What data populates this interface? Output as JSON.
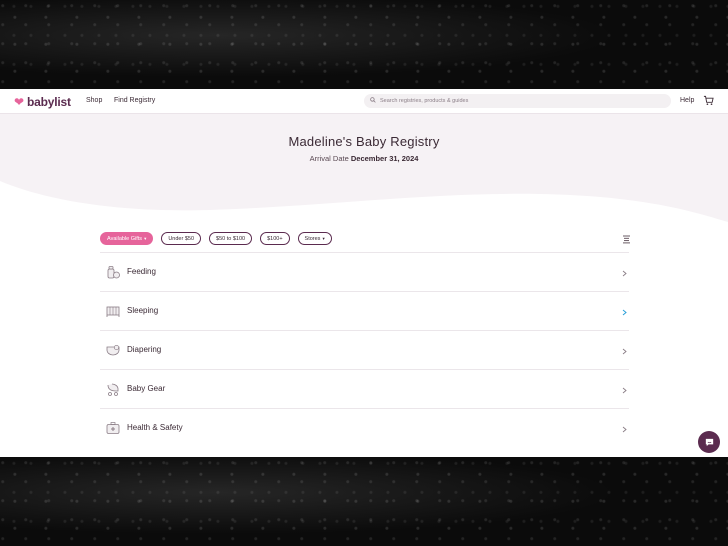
{
  "header": {
    "logo_text": "babylist",
    "nav": {
      "shop": "Shop",
      "find_registry": "Find Registry",
      "help": "Help"
    },
    "search": {
      "placeholder": "Search registries, products & guides",
      "icon": "search-icon"
    },
    "cart_icon": "cart-icon"
  },
  "hero": {
    "title": "Madeline's Baby Registry",
    "arrival_label": "Arrival Date",
    "arrival_date": "December 31, 2024"
  },
  "filters": [
    {
      "label": "Available Gifts",
      "active": true,
      "has_caret": true
    },
    {
      "label": "Under $50",
      "active": false,
      "has_caret": false
    },
    {
      "label": "$50 to $100",
      "active": false,
      "has_caret": false
    },
    {
      "label": "$100+",
      "active": false,
      "has_caret": false
    },
    {
      "label": "Stores",
      "active": false,
      "has_caret": true
    }
  ],
  "categories": [
    {
      "label": "Feeding",
      "icon": "bottle-icon"
    },
    {
      "label": "Sleeping",
      "icon": "crib-icon"
    },
    {
      "label": "Diapering",
      "icon": "diaper-icon"
    },
    {
      "label": "Baby Gear",
      "icon": "stroller-icon"
    },
    {
      "label": "Health & Safety",
      "icon": "first-aid-icon"
    }
  ],
  "colors": {
    "brand_pink": "#e6649b",
    "brand_plum": "#5b2b4f",
    "hero_bg": "#f6f2f5",
    "highlight_chevron": "#2a9fd8"
  },
  "chat_icon": "chat-icon"
}
